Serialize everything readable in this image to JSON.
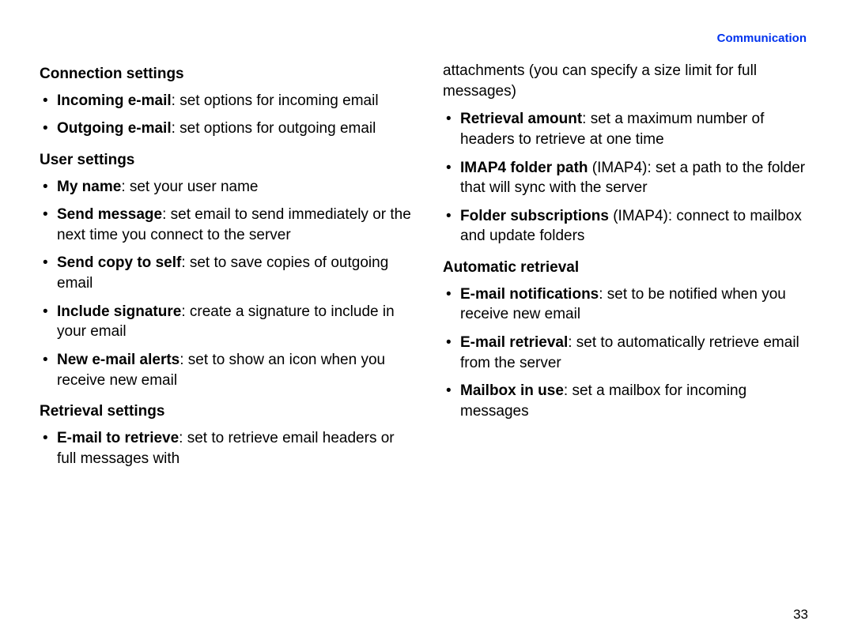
{
  "header": "Communication",
  "page_number": "33",
  "col1": {
    "sections": [
      {
        "heading": "Connection settings",
        "items": [
          {
            "term": "Incoming e-mail",
            "desc": ": set options for incoming email"
          },
          {
            "term": "Outgoing e-mail",
            "desc": ": set options for outgoing email"
          }
        ]
      },
      {
        "heading": "User settings",
        "items": [
          {
            "term": "My name",
            "desc": ": set your user name"
          },
          {
            "term": "Send message",
            "desc": ": set email to send immediately or the next time you connect to the server"
          },
          {
            "term": "Send copy to self",
            "desc": ": set to save copies of outgoing email"
          },
          {
            "term": "Include signature",
            "desc": ": create a signature to include in your email"
          },
          {
            "term": "New e-mail alerts",
            "desc": ": set to show an icon when you receive new email"
          }
        ]
      },
      {
        "heading": "Retrieval settings",
        "items": [
          {
            "term": "E-mail to retrieve",
            "desc": ": set to retrieve email headers or full messages with"
          }
        ]
      }
    ]
  },
  "col2": {
    "continuation": "attachments (you can specify a size limit for full messages)",
    "cont_items": [
      {
        "term": "Retrieval amount",
        "desc": ": set a maximum number of headers to retrieve at one time"
      },
      {
        "term": "IMAP4 folder path",
        "suffix": " (IMAP4): set a path to the folder that will sync with the server"
      },
      {
        "term": "Folder subscriptions",
        "suffix": " (IMAP4): connect to mailbox and update folders"
      }
    ],
    "sections": [
      {
        "heading": "Automatic retrieval",
        "items": [
          {
            "term": "E-mail notifications",
            "desc": ": set to be notified when you receive new email"
          },
          {
            "term": "E-mail retrieval",
            "desc": ": set to automatically retrieve email from the server"
          },
          {
            "term": "Mailbox in use",
            "desc": ": set a mailbox for incoming messages"
          }
        ]
      }
    ]
  }
}
